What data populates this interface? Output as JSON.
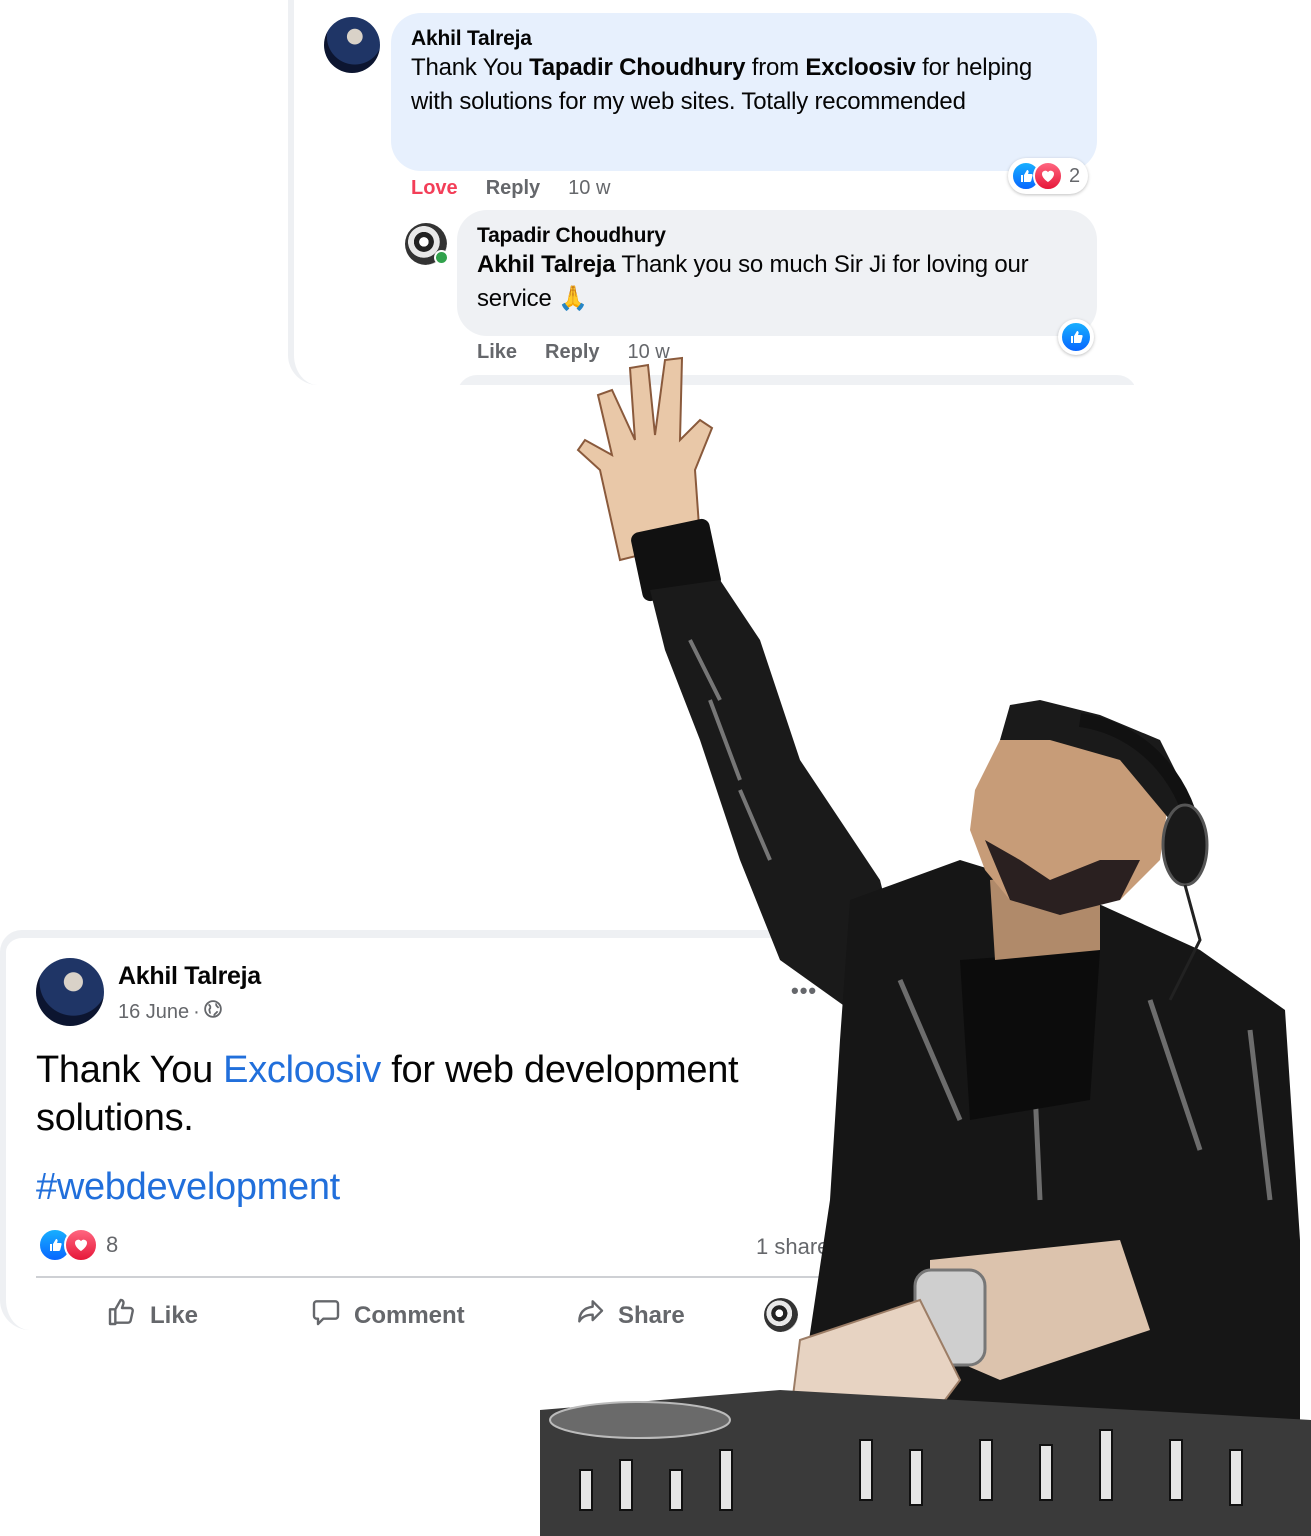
{
  "top_thread": {
    "comment": {
      "author": "Akhil Talreja",
      "text_parts": [
        {
          "text": "Thank You ",
          "bold": false
        },
        {
          "text": "Tapadir Choudhury",
          "bold": true
        },
        {
          "text": " from ",
          "bold": false
        },
        {
          "text": "Excloosiv",
          "bold": true
        },
        {
          "text": " for helping with solutions for my web sites. Totally recommended",
          "bold": false
        }
      ],
      "actions": {
        "reaction": "Love",
        "reply": "Reply",
        "time": "10 w"
      },
      "reaction_count": "2",
      "reactions": [
        "like-icon",
        "love-icon"
      ]
    },
    "reply": {
      "author": "Tapadir Choudhury",
      "mention": "Akhil Talreja",
      "text": " Thank you so much Sir Ji for loving our service ",
      "emoji": "🙏",
      "actions": {
        "like": "Like",
        "reply": "Reply",
        "time": "10 w"
      },
      "reactions": [
        "like-icon"
      ],
      "online": true
    }
  },
  "post": {
    "author": "Akhil Talreja",
    "date": "16 June",
    "separator": "·",
    "privacy_icon": "globe-icon",
    "more_label": "•••",
    "text_before": "Thank You ",
    "text_link": "Excloosiv",
    "text_after": " for web development solutions.",
    "hashtag": "#webdevelopment",
    "reaction_count": "8",
    "reactions": [
      "like-icon",
      "love-icon"
    ],
    "shares": "1 share",
    "actions": {
      "like": "Like",
      "comment": "Comment",
      "share": "Share"
    }
  },
  "colors": {
    "fb_blue": "#0866ff",
    "link_blue": "#216fdb",
    "love_red": "#f33e58",
    "muted_grey": "#65676b",
    "bubble_blue": "#e7f0fd",
    "bubble_grey": "#eff1f4"
  }
}
